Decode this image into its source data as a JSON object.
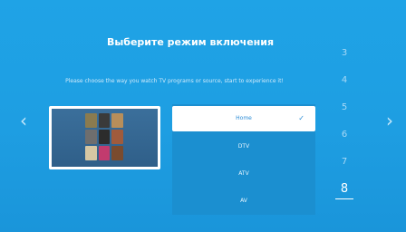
{
  "header": {
    "title": "Выберите режим включения",
    "subtitle": "Please choose the way you watch TV programs or source, start to experience it!"
  },
  "nav": {
    "left_arrow": "‹",
    "right_arrow": "›"
  },
  "options": [
    {
      "label": "Home",
      "selected": true
    },
    {
      "label": "DTV",
      "selected": false
    },
    {
      "label": "ATV",
      "selected": false
    },
    {
      "label": "AV",
      "selected": false
    }
  ],
  "check_glyph": "✓",
  "steps": [
    {
      "label": "3"
    },
    {
      "label": "4"
    },
    {
      "label": "5"
    },
    {
      "label": "6"
    },
    {
      "label": "7"
    },
    {
      "label": "8",
      "active": true
    }
  ],
  "colors": {
    "background": "#1fa3e6",
    "panel": "#1b8fd0",
    "selected_bg": "#ffffff",
    "selected_text": "#2a8bd6"
  }
}
